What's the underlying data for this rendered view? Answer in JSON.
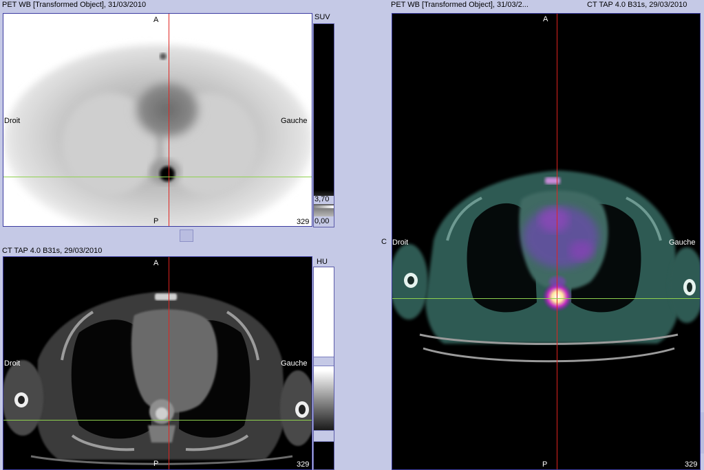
{
  "pet_view": {
    "title": "PET WB [Transformed Object], 31/03/2010",
    "orient_top": "A",
    "orient_bottom": "P",
    "orient_left": "Droit",
    "orient_right": "Gauche",
    "slice": "329",
    "colorbar_unit": "SUV",
    "colorbar_max": "3,70",
    "colorbar_min": "0,00"
  },
  "ct_view": {
    "title": "CT TAP  4.0  B31s, 29/03/2010",
    "orient_top": "A",
    "orient_bottom": "P",
    "orient_left": "Droit",
    "orient_right": "Gauche",
    "slice": "329",
    "colorbar_unit": "HU"
  },
  "fusion_view": {
    "title_left": "PET WB [Transformed Object], 31/03/2...",
    "title_right": "CT TAP  4.0  B31s, 29/03/2010",
    "orient_top": "A",
    "orient_bottom": "P",
    "orient_left_prefix": "C",
    "orient_left": "Droit",
    "orient_right": "Gauche",
    "slice": "329"
  },
  "colors": {
    "background": "#c5c9e6",
    "crosshair_vertical": "#e0231f",
    "crosshair_horizontal": "#8fd14f",
    "viewport_border": "#3a3aa0"
  }
}
